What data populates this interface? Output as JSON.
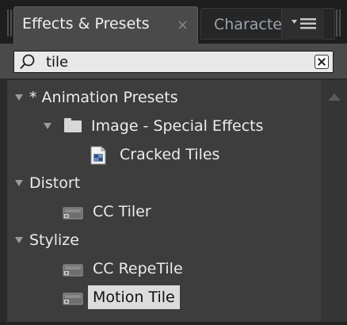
{
  "tabs": {
    "active_label": "Effects & Presets",
    "active_close": "×",
    "inactive_label": "Characte"
  },
  "search": {
    "value": "tile",
    "placeholder": ""
  },
  "tree": {
    "animation_presets": "* Animation Presets",
    "image_special_effects": "Image - Special Effects",
    "cracked_tiles": "Cracked Tiles",
    "distort": "Distort",
    "cc_tiler": "CC Tiler",
    "stylize": "Stylize",
    "cc_repetile": "CC RepeTile",
    "motion_tile": "Motion Tile"
  },
  "icons": {
    "search": "magnifier-icon",
    "clear": "clear-icon",
    "menu": "panel-menu-icon",
    "folder": "folder-icon",
    "preset": "animation-preset-icon",
    "effect": "effect-icon"
  },
  "colors": {
    "panel_bg": "#3d3d3d",
    "selection_bg": "#dcdcdc",
    "text": "#ececec"
  }
}
